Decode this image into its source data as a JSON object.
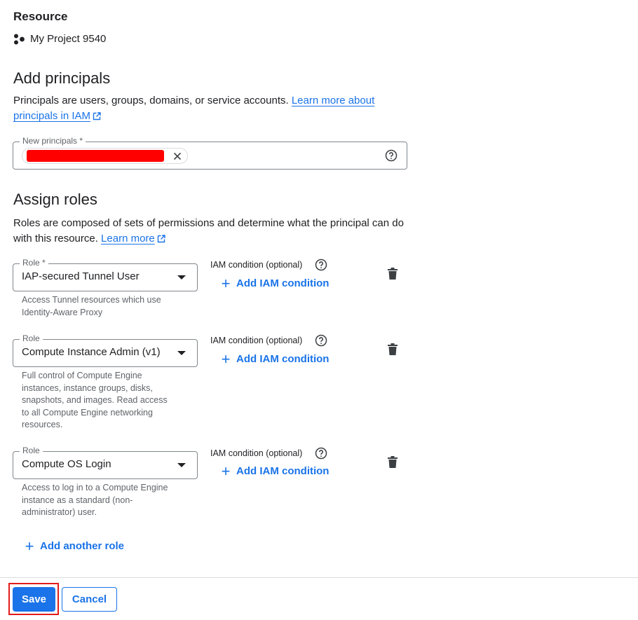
{
  "resource": {
    "heading": "Resource",
    "project_icon": "project-dots-icon",
    "project_name": "My Project 9540"
  },
  "add_principals": {
    "title": "Add principals",
    "description": "Principals are users, groups, domains, or service accounts. ",
    "learn_more_link": "Learn more about principals in IAM",
    "field_label": "New principals *",
    "chip_redacted": true
  },
  "assign_roles": {
    "title": "Assign roles",
    "description": "Roles are composed of sets of permissions and determine what the principal can do with this resource. ",
    "learn_more_link": "Learn more",
    "condition_label": "IAM condition (optional)",
    "add_condition_label": "Add IAM condition",
    "roles": [
      {
        "label": "Role *",
        "value": "IAP-secured Tunnel User",
        "hint_lines": [
          "Access Tunnel resources which use",
          "Identity-Aware Proxy"
        ]
      },
      {
        "label": "Role",
        "value": "Compute Instance Admin (v1)",
        "hint_lines": [
          "Full control of Compute Engine",
          "instances, instance groups, disks,",
          "snapshots, and images. Read access",
          "to all Compute Engine networking",
          "resources."
        ]
      },
      {
        "label": "Role",
        "value": "Compute OS Login",
        "hint_lines": [
          "Access to log in to a Compute Engine",
          "instance as a standard (non-",
          "administrator) user."
        ]
      }
    ],
    "add_another_role": "Add another role"
  },
  "footer": {
    "save_label": "Save",
    "cancel_label": "Cancel"
  },
  "colors": {
    "accent": "#1a73e8",
    "highlight": "#e31b1b",
    "redaction": "#ff0000"
  }
}
